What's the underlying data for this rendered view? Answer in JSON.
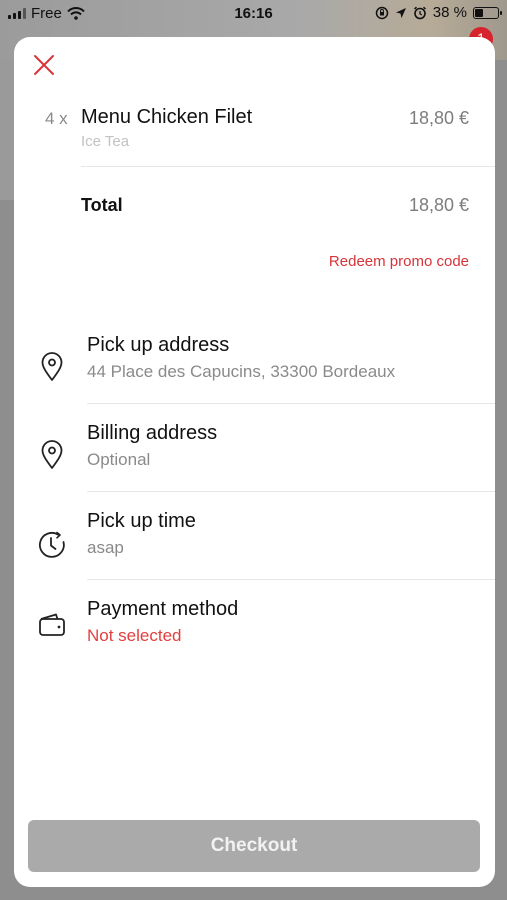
{
  "status_bar": {
    "carrier": "Free",
    "time": "16:16",
    "battery": "38 %",
    "battery_level": 0.38,
    "notification_count": "1"
  },
  "sheet": {
    "close_icon": "close-icon",
    "order": {
      "quantity": "4 x",
      "name": "Menu Chicken Filet",
      "variant": "Ice Tea",
      "price": "18,80 €"
    },
    "total": {
      "label": "Total",
      "value": "18,80 €"
    },
    "promo_label": "Redeem promo code",
    "details": [
      {
        "icon": "location-pin-icon",
        "title": "Pick up address",
        "value": "44 Place des Capucins, 33300 Bordeaux"
      },
      {
        "icon": "location-pin-icon",
        "title": "Billing address",
        "value": "Optional"
      },
      {
        "icon": "clock-icon",
        "title": "Pick up time",
        "value": "asap"
      },
      {
        "icon": "wallet-icon",
        "title": "Payment method",
        "value": "Not selected"
      }
    ],
    "checkout_label": "Checkout"
  },
  "colors": {
    "accent_red": "#d8333a",
    "checkout_disabled": "#aaaaaa"
  }
}
